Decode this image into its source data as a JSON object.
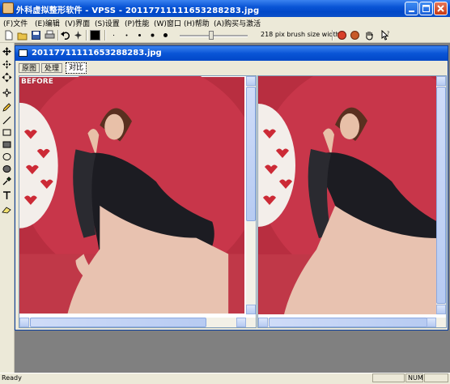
{
  "window": {
    "title": "外科虚拟整形软件 - VPSS - 20117711111653288283.jpg"
  },
  "menu": {
    "items": [
      {
        "key": "file",
        "label": "(F)文件"
      },
      {
        "key": "edit",
        "label": "(E)编辑"
      },
      {
        "key": "view",
        "label": "(V)界面"
      },
      {
        "key": "settings",
        "label": "(S)设置"
      },
      {
        "key": "performance",
        "label": "(P)性能"
      },
      {
        "key": "window",
        "label": "(W)窗口"
      },
      {
        "key": "help",
        "label": "(H)帮助"
      },
      {
        "key": "buy",
        "label": "(A)购买与激活"
      }
    ]
  },
  "toolbar": {
    "brush_size_label": "218 pix brush size width",
    "brush_color": "#000000"
  },
  "document": {
    "title": "20117711111653288283.jpg",
    "tabs": [
      {
        "key": "original",
        "label": "原图"
      },
      {
        "key": "process",
        "label": "处理"
      },
      {
        "key": "compare",
        "label": "对比"
      }
    ],
    "active_tab": "对比",
    "before_label": "BEFORE"
  },
  "status": {
    "left": "Ready",
    "num": "NUM"
  },
  "colors": {
    "title_blue": "#0a55d6",
    "photo_red": "#c8364a",
    "photo_bg": "#b82e40",
    "workspace": "#808080"
  }
}
